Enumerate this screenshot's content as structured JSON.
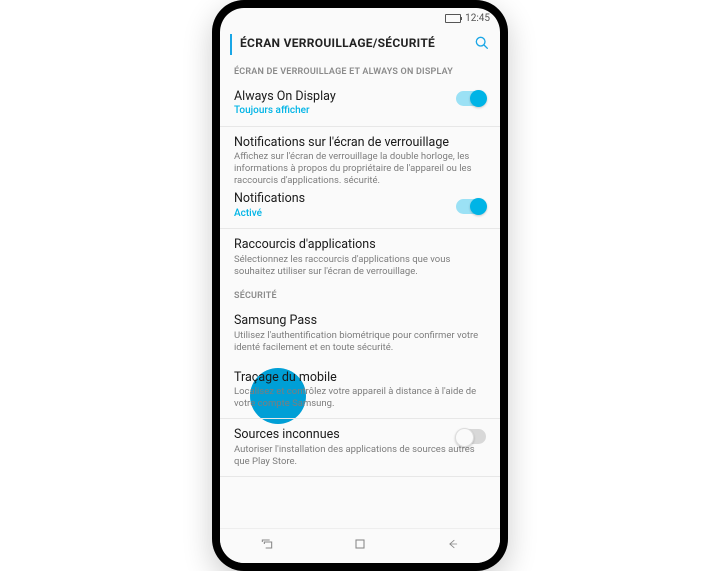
{
  "status": {
    "time": "12:45"
  },
  "header": {
    "title": "ÉCRAN VERROUILLAGE/SÉCURITÉ"
  },
  "sections": {
    "lock_display": "ÉCRAN DE VERROUILLAGE ET ALWAYS ON DISPLAY",
    "security": "SÉCURITÉ"
  },
  "items": {
    "aod": {
      "title": "Always On Display",
      "sub": "Toujours afficher",
      "toggle": true
    },
    "lock_notif_header": {
      "title": "Notifications sur l'écran de verrouillage",
      "sub": "Affichez sur l'écran de verrouillage la double horloge, les informations à propos du propriétaire de l'appareil ou les raccourcis d'applications. sécurité."
    },
    "notifications": {
      "title": "Notifications",
      "sub": "Activé",
      "toggle": true
    },
    "shortcuts": {
      "title": "Raccourcis d'applications",
      "sub": "Sélectionnez les raccourcis d'applications que vous souhaitez utiliser sur l'écran de verrouillage."
    },
    "samsung_pass": {
      "title": "Samsung Pass",
      "sub": "Utilisez l'authentification biométrique pour confirmer votre identé facilement et en toute sécurité."
    },
    "find_mobile": {
      "title": "Traçage du mobile",
      "sub": "Localisez et contrôlez votre appareil à distance à l'aide de votre compte Samsung."
    },
    "unknown_sources": {
      "title": "Sources inconnues",
      "sub": "Autoriser l'installation des applications de sources autres que Play Store.",
      "toggle": false
    }
  },
  "colors": {
    "accent": "#00b4e6"
  }
}
